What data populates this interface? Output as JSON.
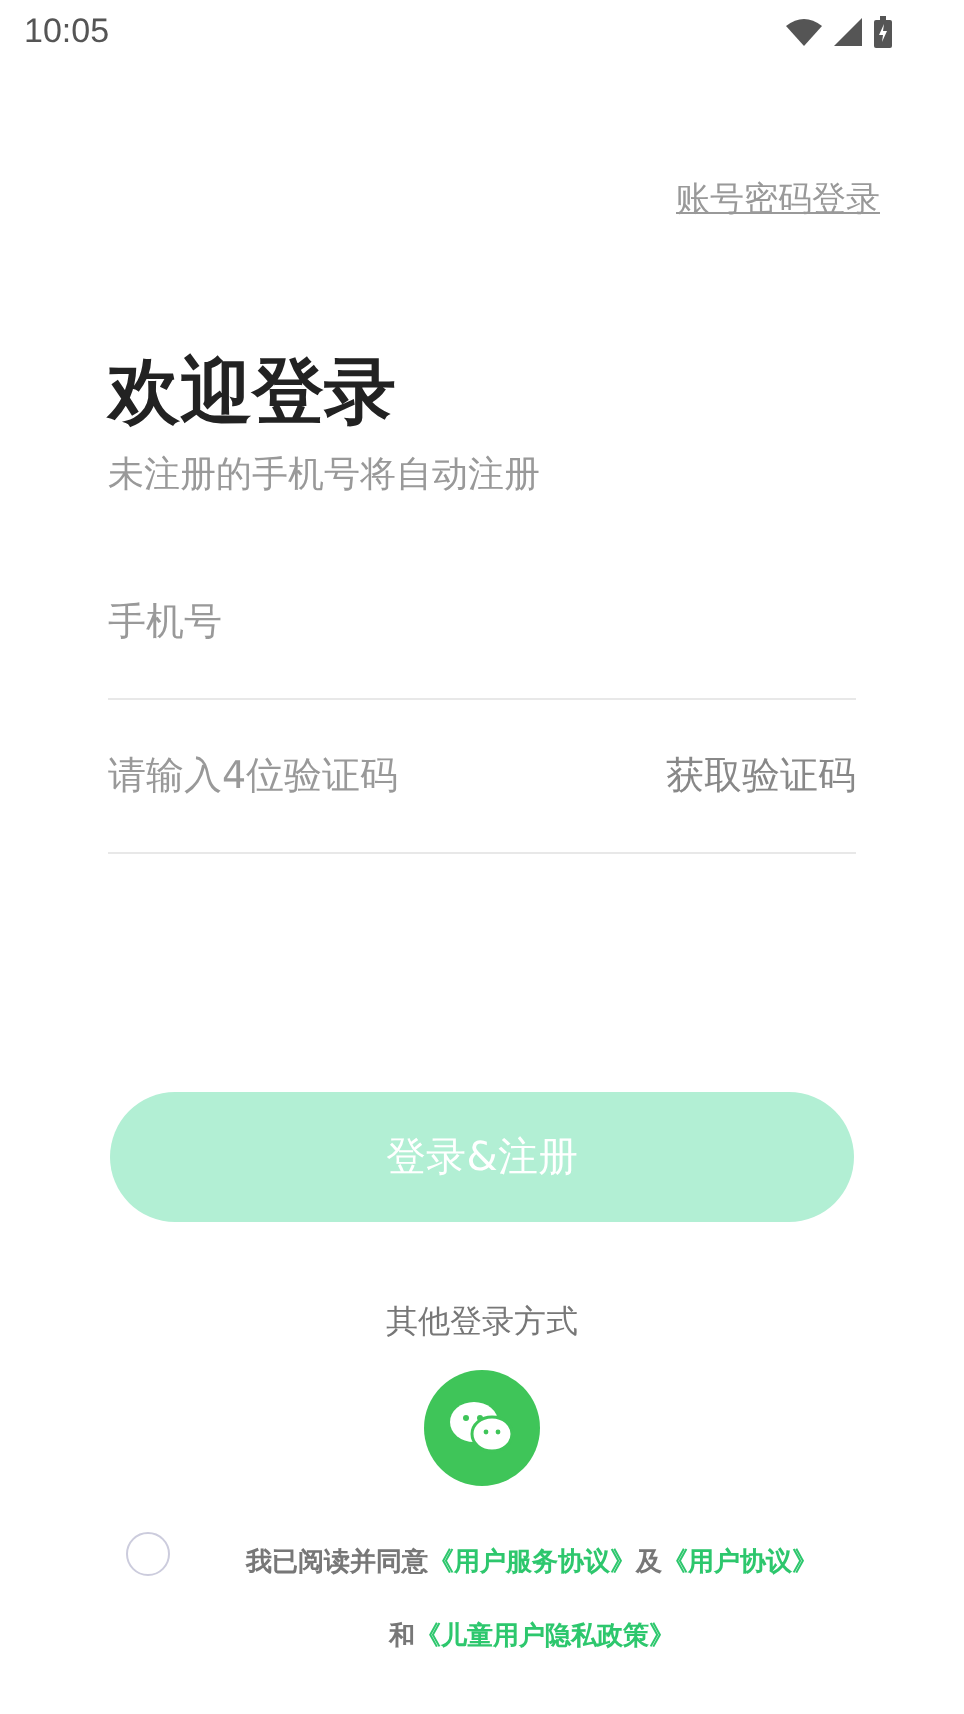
{
  "status_bar": {
    "time": "10:05"
  },
  "password_login_link": "账号密码登录",
  "title": "欢迎登录",
  "subtitle": "未注册的手机号将自动注册",
  "phone_field": {
    "placeholder": "手机号"
  },
  "code_field": {
    "placeholder": "请输入4位验证码",
    "action": "获取验证码"
  },
  "submit_button": {
    "label": "登录&注册",
    "disabled": true
  },
  "other_login": {
    "label": "其他登录方式"
  },
  "agreement": {
    "checked": false,
    "prefix": "我已阅读并同意",
    "link_1": "《用户服务协议》",
    "joiner_1": "及",
    "link_2": "《用户协议》",
    "joiner_2": "和",
    "link_3": "《儿童用户隐私政策》"
  }
}
